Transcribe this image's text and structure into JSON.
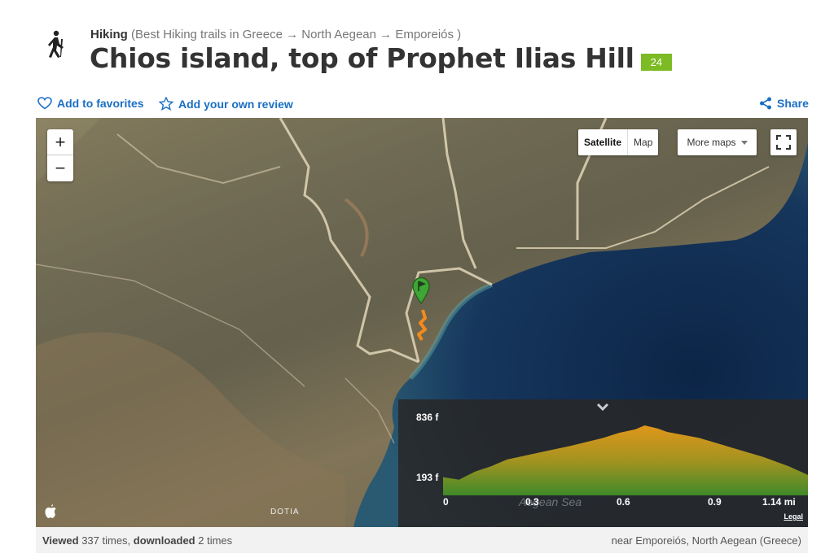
{
  "header": {
    "activity": "Hiking",
    "breadcrumb": "(Best Hiking trails in Greece → North Aegean → Emporeiós )",
    "title": "Chios island, top of Prophet Ilias Hill",
    "badge": "24",
    "activity_icon": "hiker-icon"
  },
  "actions": {
    "favorites": "Add to favorites",
    "review": "Add your own review",
    "share": "Share",
    "link_color": "#1a6fc4"
  },
  "map": {
    "zoom_in": "+",
    "zoom_out": "−",
    "type_satellite": "Satellite",
    "type_map": "Map",
    "more_maps": "More maps",
    "place_label": "DOTIA",
    "track_color": "#f28a1e",
    "marker_color": "#3fa535"
  },
  "elevation": {
    "max_label": "836 f",
    "min_label": "193 f",
    "x_ticks": [
      "0",
      "0.3",
      "0.6",
      "0.9",
      "1.14 mi"
    ],
    "sea_label": "Aegean Sea",
    "legal": "Legal"
  },
  "footer": {
    "viewed_word": "Viewed",
    "viewed_count": "337 times,",
    "downloaded_word": "downloaded",
    "downloaded_count": "2 times",
    "location": "near Emporeiós, North Aegean (Greece)"
  },
  "chart_data": {
    "type": "area",
    "title": "",
    "xlabel": "",
    "ylabel": "",
    "x_unit": "mi",
    "y_unit": "f",
    "xlim": [
      0,
      1.14
    ],
    "ylim": [
      193,
      836
    ],
    "x_ticks": [
      0,
      0.3,
      0.6,
      0.9,
      1.14
    ],
    "x": [
      0,
      0.05,
      0.1,
      0.15,
      0.2,
      0.3,
      0.4,
      0.5,
      0.55,
      0.6,
      0.63,
      0.67,
      0.7,
      0.8,
      0.9,
      1.0,
      1.08,
      1.14
    ],
    "y": [
      235,
      205,
      300,
      360,
      440,
      520,
      600,
      690,
      750,
      790,
      836,
      800,
      760,
      690,
      580,
      470,
      360,
      260
    ]
  }
}
